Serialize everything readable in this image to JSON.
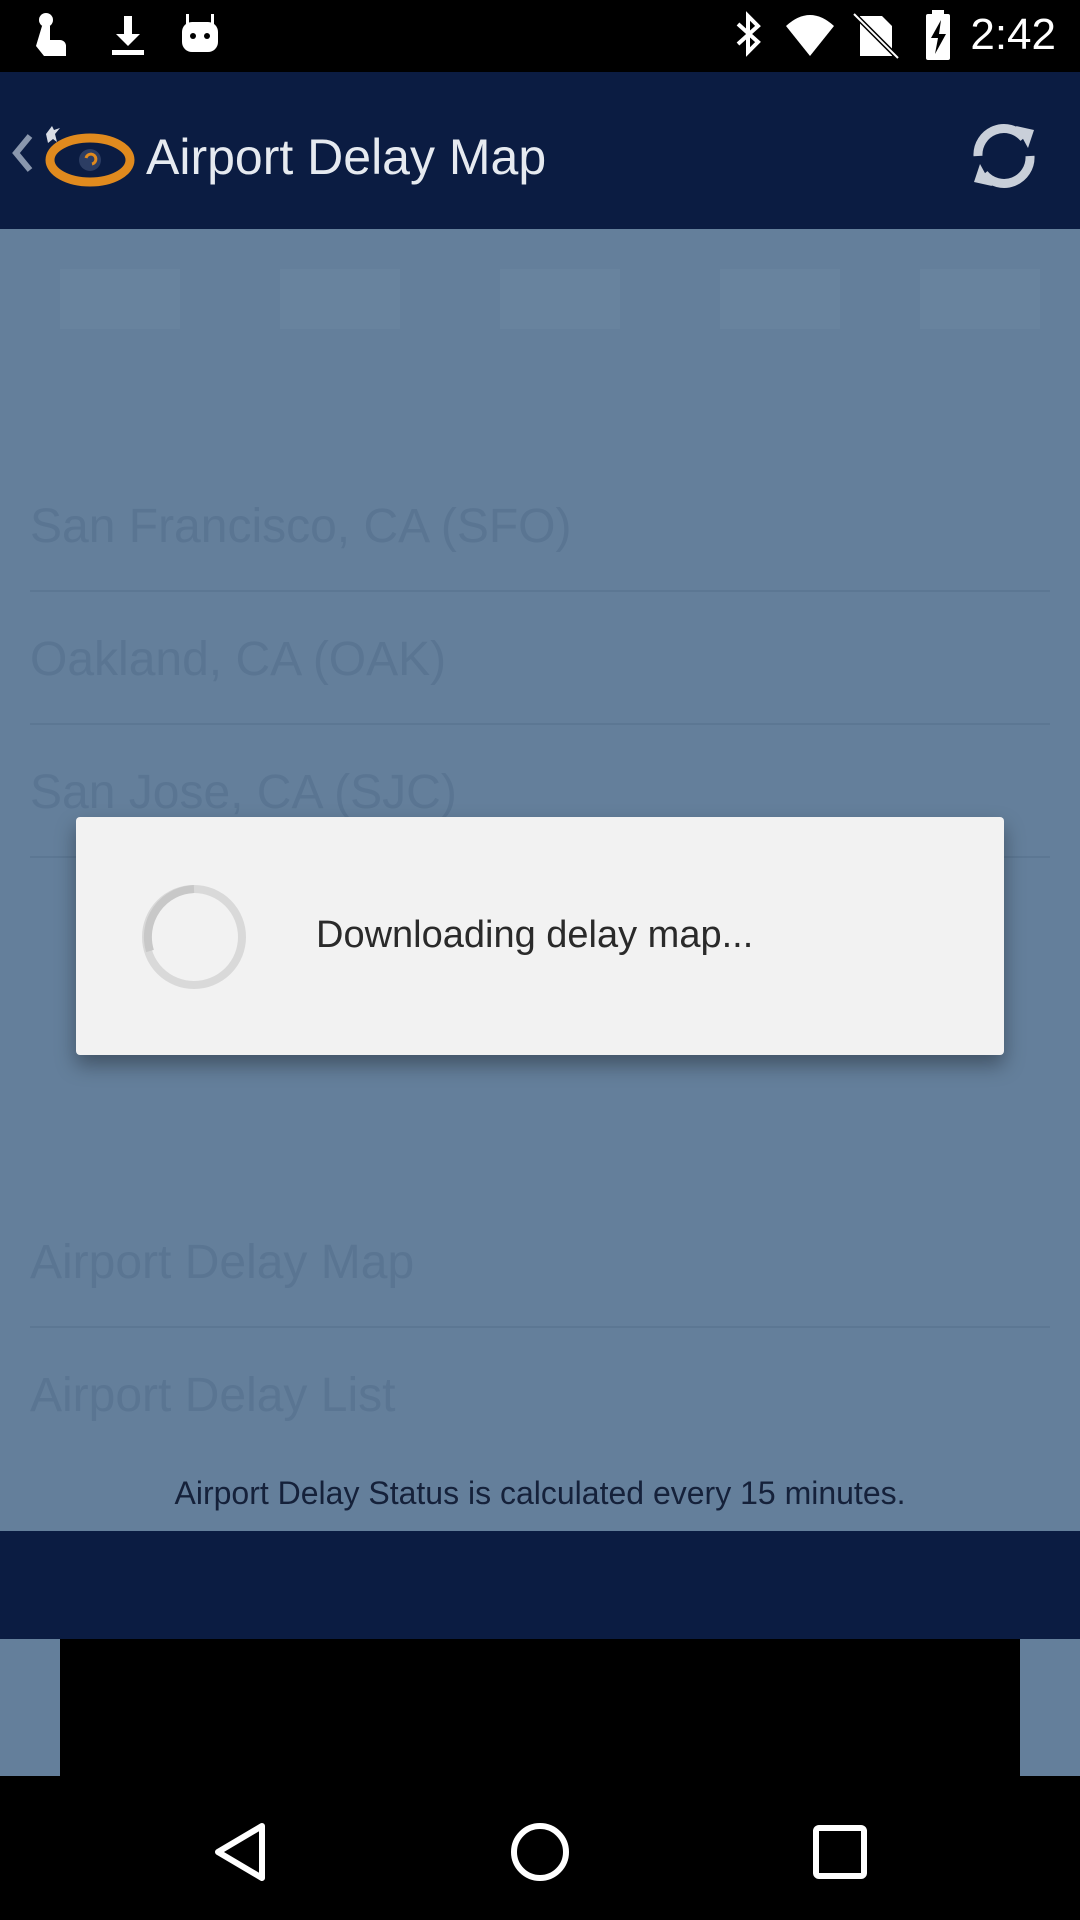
{
  "status_bar": {
    "time": "2:42",
    "left_icons": [
      "touch-hand-icon",
      "download-icon",
      "android-robot-icon"
    ],
    "right_icons": [
      "bluetooth-icon",
      "wifi-icon",
      "no-sim-icon",
      "battery-charging-icon"
    ]
  },
  "app_bar": {
    "title": "Airport Delay Map",
    "back_icon": "chevron-left-icon",
    "logo_icon": "airport-eye-logo-icon",
    "refresh_icon": "refresh-icon"
  },
  "list": {
    "items": [
      {
        "label": "San Francisco, CA (SFO)"
      },
      {
        "label": "Oakland, CA (OAK)"
      },
      {
        "label": "San Jose, CA (SJC)"
      },
      {
        "label": "Airport Delay Map"
      },
      {
        "label": "Airport Delay List"
      }
    ]
  },
  "footer": {
    "note": "Airport Delay Status is calculated every 15 minutes."
  },
  "dialog": {
    "message": "Downloading delay map..."
  },
  "nav_bar": {
    "icons": [
      "back-triangle-icon",
      "home-circle-icon",
      "recents-square-icon"
    ]
  },
  "colors": {
    "app_bar": "#0b1c42",
    "dimmed_background": "#647f9b",
    "dialog_background": "#f2f2f2",
    "logo_orange": "#e08a1e"
  }
}
